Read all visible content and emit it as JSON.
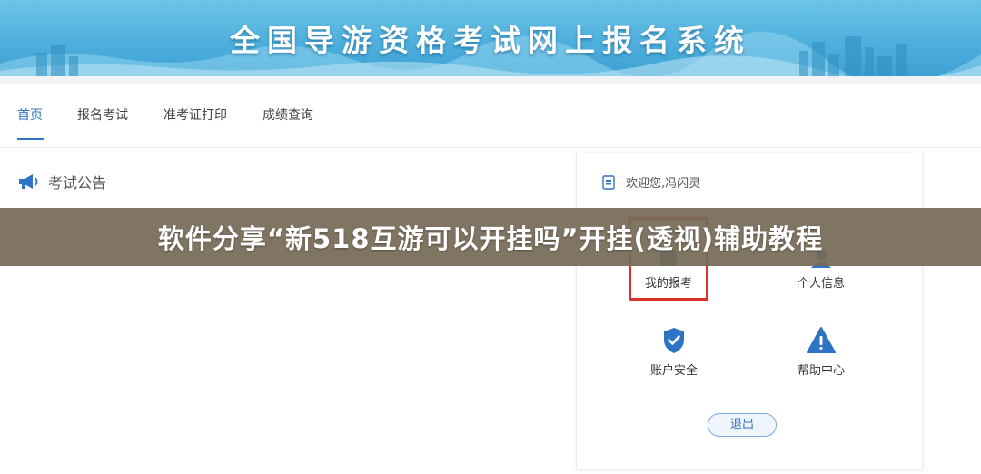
{
  "header": {
    "title": "全国导游资格考试网上报名系统"
  },
  "nav": {
    "items": [
      {
        "label": "首页",
        "active": true
      },
      {
        "label": "报名考试",
        "active": false
      },
      {
        "label": "准考证打印",
        "active": false
      },
      {
        "label": "成绩查询",
        "active": false
      }
    ]
  },
  "announcement": {
    "icon": "megaphone-icon",
    "title": "考试公告"
  },
  "user_panel": {
    "welcome_icon": "user-card-icon",
    "welcome_text": "欢迎您,冯闪灵",
    "items": [
      {
        "label": "我的报考",
        "icon": "my-registration-icon",
        "highlighted": true
      },
      {
        "label": "个人信息",
        "icon": "personal-info-icon",
        "highlighted": false
      },
      {
        "label": "账户安全",
        "icon": "shield-check-icon",
        "highlighted": false
      },
      {
        "label": "帮助中心",
        "icon": "warning-triangle-icon",
        "highlighted": false
      }
    ],
    "logout_label": "退出"
  },
  "overlay": {
    "caption": "软件分享“新518互游可以开挂吗”开挂(透视)辅助教程"
  },
  "colors": {
    "accent": "#2d74c4",
    "banner": "#4fb0dd",
    "highlight_border": "#d8322b",
    "overlay_bg": "#766a56"
  }
}
